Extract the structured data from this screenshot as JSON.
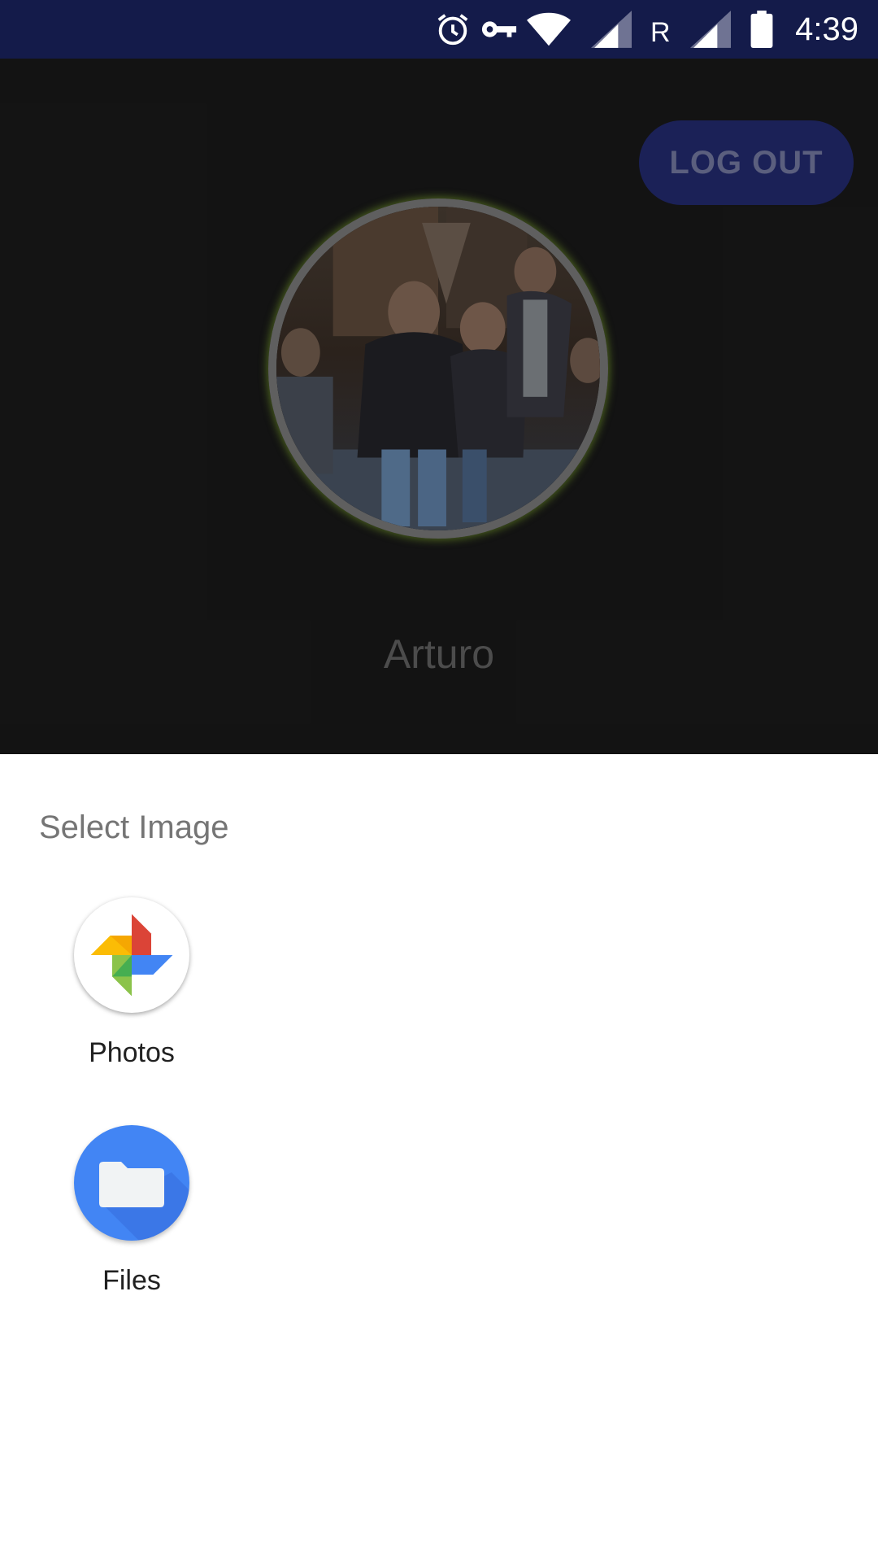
{
  "status_bar": {
    "time": "4:39",
    "roaming_indicator": "R",
    "icons": [
      "alarm-icon",
      "vpn-key-icon",
      "wifi-icon",
      "signal-icon",
      "signal-icon"
    ]
  },
  "profile": {
    "logout_label": "LOG OUT",
    "name": "Arturo"
  },
  "chooser": {
    "title": "Select Image",
    "apps": [
      {
        "label": "Photos",
        "icon": "google-photos-icon"
      },
      {
        "label": "Files",
        "icon": "files-folder-icon"
      }
    ]
  },
  "colors": {
    "status_bar": "#141b4a",
    "logout_button": "#1b2157",
    "app_background": "#1d1d1d",
    "sheet_background": "#ffffff",
    "files_blue": "#4285f4"
  }
}
